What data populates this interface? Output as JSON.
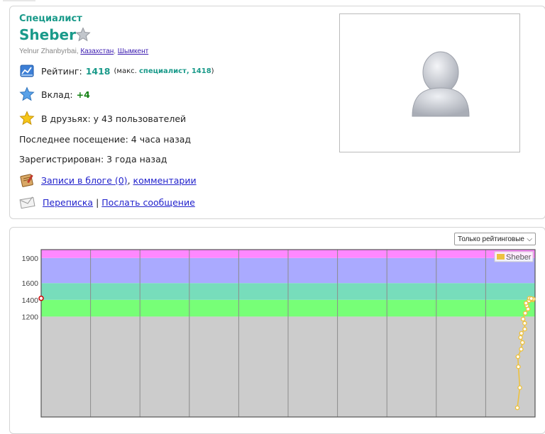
{
  "profile": {
    "rank": "Специалист",
    "handle": "Sheber",
    "full_name": "Yelnur Zhanbyrbai",
    "country": "Казахстан",
    "city": "Шымкент",
    "rating_label": "Рейтинг:",
    "rating_value": "1418",
    "max_prefix": "(макс.",
    "max_rank": "специалист,",
    "max_value": "1418",
    "max_suffix": ")",
    "contribution_label": "Вклад:",
    "contribution_value": "+4",
    "friends_text": "В друзьях: у 43 пользователей",
    "last_visit": "Последнее посещение: 4 часа назад",
    "registered": "Зарегистрирован: 3 года назад",
    "blog_link": "Записи в блоге (0)",
    "comments_link": "комментарии",
    "talk_link": "Переписка",
    "send_message_link": "Послать сообщение"
  },
  "colors": {
    "rank": "#1a9a8a",
    "contribution": "#138013",
    "avatar_head": "#b7bbc4"
  },
  "icons": {
    "rank_star": "star-gray-icon",
    "rating": "rating-chart-icon",
    "contribution": "star-blue-icon",
    "friends": "star-gold-icon",
    "blog": "blog-notebook-icon",
    "messages": "envelope-icon"
  },
  "chart_controls": {
    "filter_value": "Только рейтинговые"
  },
  "chart_data": {
    "type": "line",
    "ylim": [
      0,
      2000
    ],
    "yticks": [
      1200,
      1400,
      1600,
      1900
    ],
    "bands": [
      {
        "from": 0,
        "to": 1200,
        "color": "#cccccc"
      },
      {
        "from": 1200,
        "to": 1400,
        "color": "#77ff77"
      },
      {
        "from": 1400,
        "to": 1600,
        "color": "#77ddbb"
      },
      {
        "from": 1600,
        "to": 1900,
        "color": "#aaaaff"
      },
      {
        "from": 1900,
        "to": 2000,
        "color": "#ff88ff"
      }
    ],
    "grid_divisions": 10,
    "legend": {
      "name": "Sheber",
      "color": "#edc240",
      "position": "top-right"
    },
    "series": [
      {
        "name": "Sheber",
        "color": "#edc240",
        "values": [
          110,
          350,
          600,
          720,
          810,
          890,
          950,
          1000,
          1050,
          1120,
          1170,
          1240,
          1290,
          1330,
          1360,
          1390,
          1410,
          1390,
          1418,
          1400,
          1410,
          1415
        ]
      }
    ],
    "selected_marker": {
      "value": 1418,
      "color": "#cc0000"
    }
  }
}
